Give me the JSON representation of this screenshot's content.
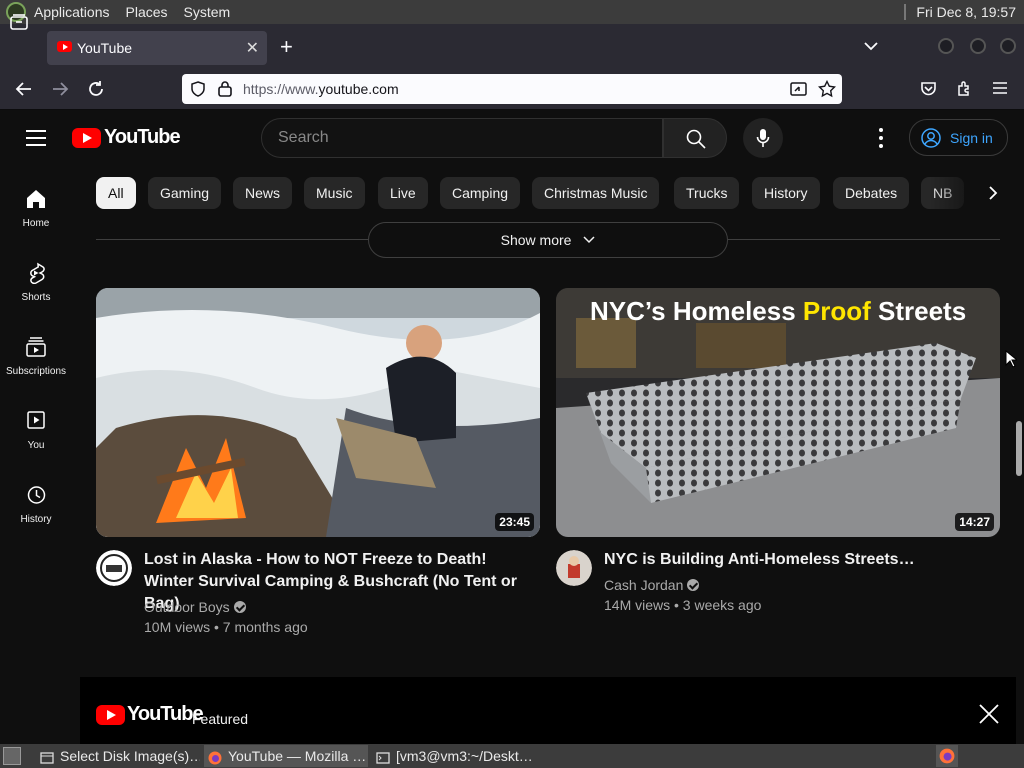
{
  "top_panel": {
    "menus": [
      "Applications",
      "Places",
      "System"
    ],
    "clock": "Fri Dec  8, 19:57"
  },
  "browser": {
    "tab": {
      "title": "YouTube",
      "close_glyph": "✕"
    },
    "new_tab_glyph": "+",
    "url": {
      "scheme": "https://www.",
      "domain": "youtube.com"
    }
  },
  "youtube": {
    "logo_text": "YouTube",
    "search_placeholder": "Search",
    "sign_in": "Sign in",
    "guide": [
      {
        "label": "Home",
        "icon": "home-icon"
      },
      {
        "label": "Shorts",
        "icon": "shorts-icon"
      },
      {
        "label": "Subscriptions",
        "icon": "subscriptions-icon"
      },
      {
        "label": "You",
        "icon": "you-icon"
      },
      {
        "label": "History",
        "icon": "history-icon"
      }
    ],
    "chips": [
      "All",
      "Gaming",
      "News",
      "Music",
      "Live",
      "Camping",
      "Christmas Music",
      "Trucks",
      "History",
      "Debates",
      "NB"
    ],
    "show_more": "Show more",
    "videos": [
      {
        "title": "Lost in Alaska - How to NOT Freeze to Death! Winter Survival Camping & Bushcraft (No Tent or Bag)",
        "channel": "Outdoor Boys",
        "meta": "10M views • 7 months ago",
        "duration": "23:45"
      },
      {
        "title": "NYC is Building Anti-Homeless Streets…",
        "channel": "Cash Jordan",
        "meta": "14M views • 3 weeks ago",
        "duration": "14:27",
        "thumb_text": "NYC’s Homeless Proof Streets"
      }
    ],
    "featured": {
      "logo_text": "YouTube",
      "label": "Featured"
    }
  },
  "taskbar": {
    "tasks": [
      "Select Disk Image(s)…",
      "YouTube — Mozilla …",
      "[vm3@vm3:~/Deskt…"
    ]
  },
  "colors": {
    "yt_red": "#ff0000",
    "link_blue": "#3ea6ff",
    "bg": "#0f0f0f"
  }
}
